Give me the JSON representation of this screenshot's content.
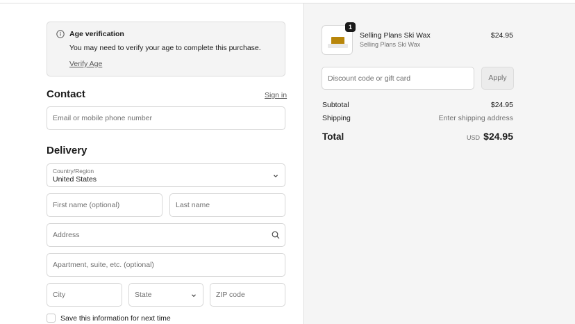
{
  "notice": {
    "title": "Age verification",
    "message": "You may need to verify your age to complete this purchase.",
    "link": "Verify Age"
  },
  "contact": {
    "title": "Contact",
    "signin": "Sign in",
    "email_placeholder": "Email or mobile phone number"
  },
  "delivery": {
    "title": "Delivery",
    "country_label": "Country/Region",
    "country_value": "United States",
    "first_name_placeholder": "First name (optional)",
    "last_name_placeholder": "Last name",
    "address_placeholder": "Address",
    "apartment_placeholder": "Apartment, suite, etc. (optional)",
    "city_placeholder": "City",
    "state_placeholder": "State",
    "zip_placeholder": "ZIP code",
    "save_info_label": "Save this information for next time"
  },
  "summary": {
    "item": {
      "quantity": "1",
      "name": "Selling Plans Ski Wax",
      "variant": "Selling Plans Ski Wax",
      "price": "$24.95"
    },
    "discount_placeholder": "Discount code or gift card",
    "apply_label": "Apply",
    "subtotal_label": "Subtotal",
    "subtotal_value": "$24.95",
    "shipping_label": "Shipping",
    "shipping_value": "Enter shipping address",
    "total_label": "Total",
    "total_currency": "USD",
    "total_value": "$24.95"
  },
  "colors": {
    "accent": "#1a1a1a",
    "muted": "#707070",
    "summary_bg": "#f5f5f5"
  }
}
